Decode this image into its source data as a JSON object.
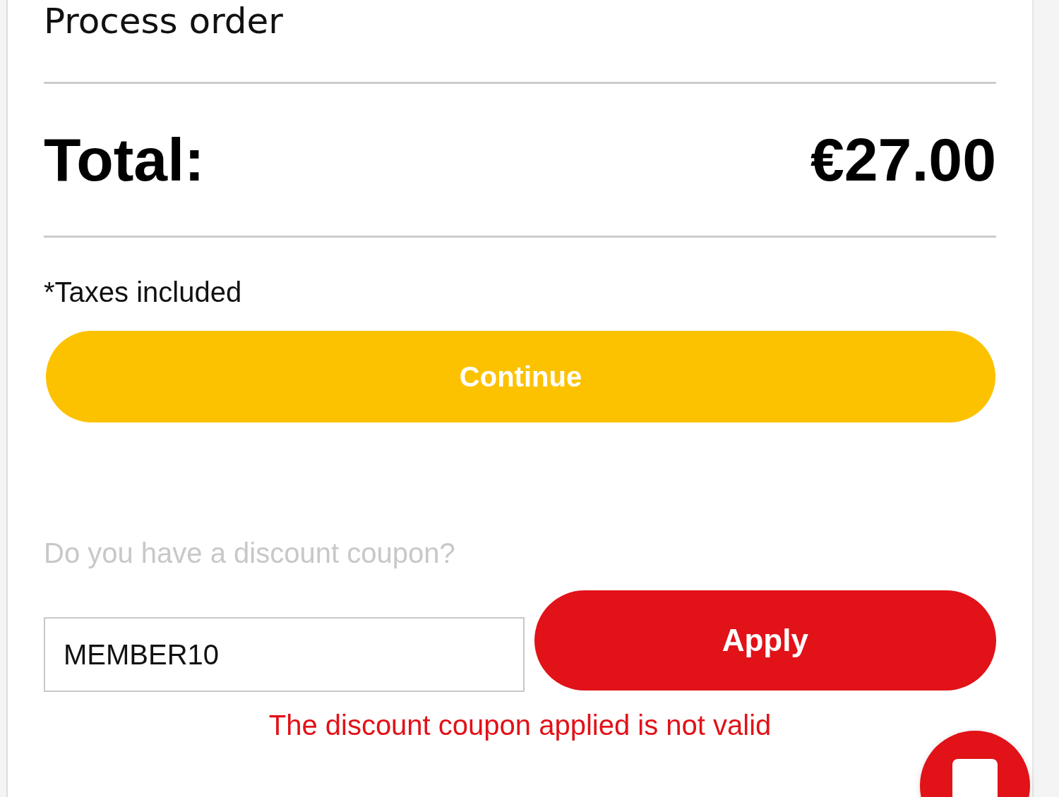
{
  "title": "Process order",
  "total": {
    "label": "Total:",
    "amount": "€27.00"
  },
  "taxes_note": "*Taxes included",
  "continue_button": "Continue",
  "coupon": {
    "label": "Do you have a discount coupon?",
    "value": "MEMBER10",
    "apply_button": "Apply",
    "error": "The discount coupon applied is not valid"
  }
}
